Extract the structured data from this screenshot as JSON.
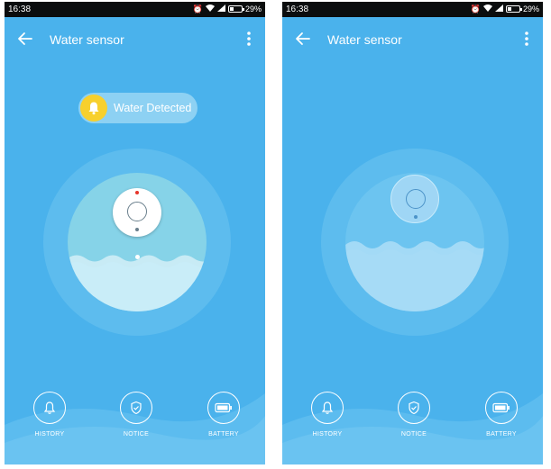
{
  "screens": [
    {
      "id": "left",
      "status_time": "16:38",
      "status_battery": "29%",
      "title": "Water sensor",
      "alert_text": "Water Detected",
      "nav": [
        {
          "label": "HISTORY",
          "icon": "bell-icon"
        },
        {
          "label": "NOTICE",
          "icon": "shield-icon"
        },
        {
          "label": "BATTERY",
          "icon": "battery-icon"
        }
      ]
    },
    {
      "id": "right",
      "status_time": "16:38",
      "status_battery": "29%",
      "title": "Water sensor",
      "nav": [
        {
          "label": "HISTORY",
          "icon": "bell-icon"
        },
        {
          "label": "NOTICE",
          "icon": "shield-icon"
        },
        {
          "label": "BATTERY",
          "icon": "battery-icon"
        }
      ]
    }
  ],
  "colors": {
    "background": "#4ab2ec",
    "status_bar": "#0b0d0e",
    "alert_badge": "#f7d02d",
    "alert_pill": "#8dd1f3"
  }
}
